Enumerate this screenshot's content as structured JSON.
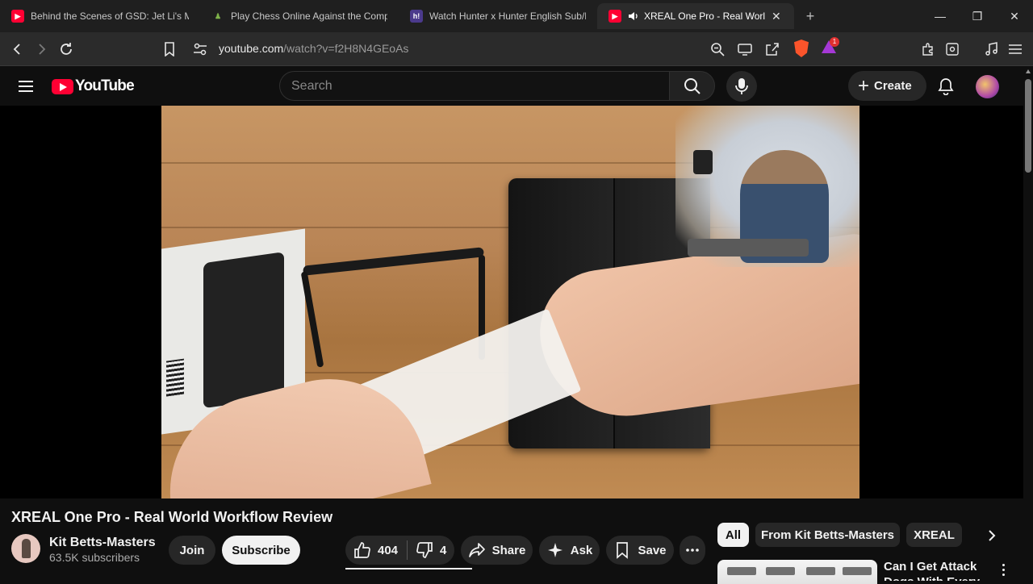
{
  "browser": {
    "tabs": [
      {
        "title": "Behind the Scenes of GSD: Jet Li's Mo",
        "favicon": "youtube-icon",
        "active": false
      },
      {
        "title": "Play Chess Online Against the Compu",
        "favicon": "chess-pawn-icon",
        "active": false
      },
      {
        "title": "Watch Hunter x Hunter English Sub/D",
        "favicon": "hianime-icon",
        "active": false
      },
      {
        "title": "XREAL One Pro - Real World W",
        "favicon": "youtube-icon",
        "active": true,
        "audio": true
      }
    ],
    "favicon_hi_text": "h!",
    "url_host": "youtube.com",
    "url_path": "/watch?v=f2H8N4GEoAs",
    "rewards_badge": "1"
  },
  "youtube": {
    "logo_text": "YouTube",
    "search_placeholder": "Search",
    "create_label": "Create"
  },
  "video": {
    "title": "XREAL One Pro - Real World Workflow Review",
    "channel_name": "Kit Betts-Masters",
    "subscribers": "63.5K subscribers",
    "join_label": "Join",
    "subscribe_label": "Subscribe",
    "likes": "404",
    "dislikes": "4",
    "share_label": "Share",
    "ask_label": "Ask",
    "save_label": "Save"
  },
  "sidebar": {
    "chips": [
      "All",
      "From Kit Betts-Masters",
      "XREAL"
    ],
    "selected_chip": "All",
    "recommendation_title": "Can I Get Attack Dogs With Every"
  },
  "colors": {
    "youtube_red": "#ff0033",
    "background": "#0f0f0f",
    "button_bg": "#272727"
  }
}
